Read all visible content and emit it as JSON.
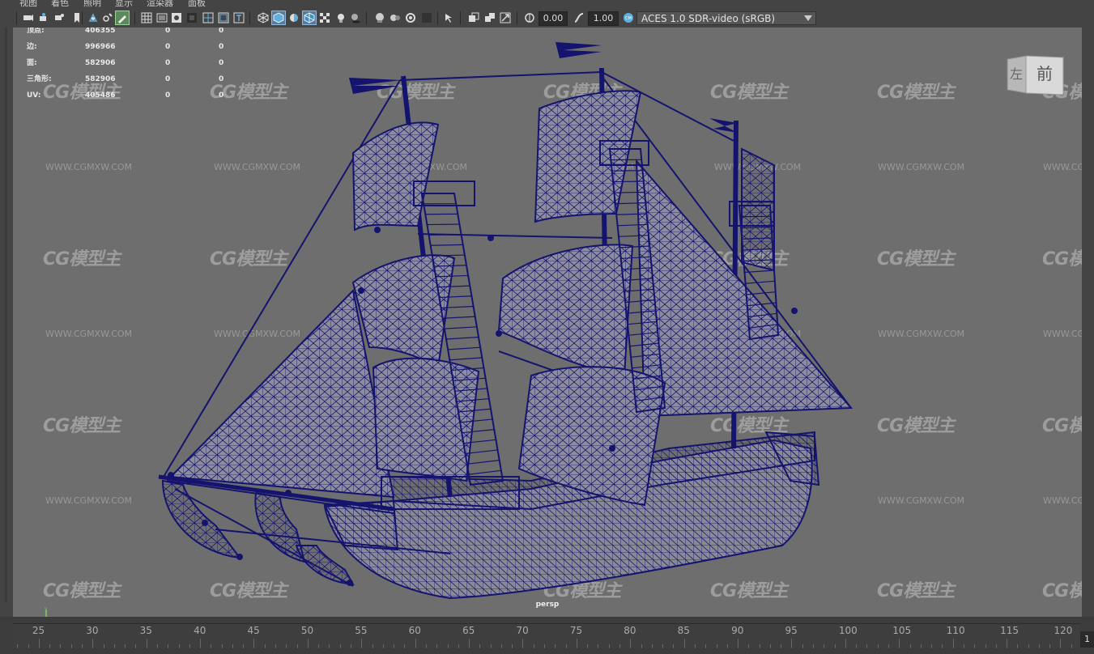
{
  "menu": [
    "视图",
    "着色",
    "照明",
    "显示",
    "渲染器",
    "面板"
  ],
  "toolbar": {
    "exposure_value": "0.00",
    "gamma_value": "1.00",
    "color_space": "ACES 1.0 SDR-video (sRGB)"
  },
  "hud": {
    "rows": [
      {
        "label": "顶点:",
        "count": "406355",
        "sel": "0",
        "comp": "0"
      },
      {
        "label": "边:",
        "count": "996966",
        "sel": "0",
        "comp": "0"
      },
      {
        "label": "面:",
        "count": "582906",
        "sel": "0",
        "comp": "0"
      },
      {
        "label": "三角形:",
        "count": "582906",
        "sel": "0",
        "comp": "0"
      },
      {
        "label": "UV:",
        "count": "405486",
        "sel": "0",
        "comp": "0"
      }
    ]
  },
  "viewcube": {
    "left": "左",
    "front": "前"
  },
  "camera_label": "persp",
  "watermark": {
    "logo": "CG模型主",
    "url": "WWW.CGMXW.COM"
  },
  "timeline": {
    "ticks": [
      "25",
      "30",
      "35",
      "40",
      "45",
      "50",
      "55",
      "60",
      "65",
      "70",
      "75",
      "80",
      "85",
      "90",
      "95",
      "100",
      "105",
      "110",
      "115",
      "120"
    ],
    "current_frame": "1"
  },
  "colors": {
    "wire": "#14146e",
    "viewport_bg": "#6e6e6e",
    "panel_bg": "#444444"
  }
}
